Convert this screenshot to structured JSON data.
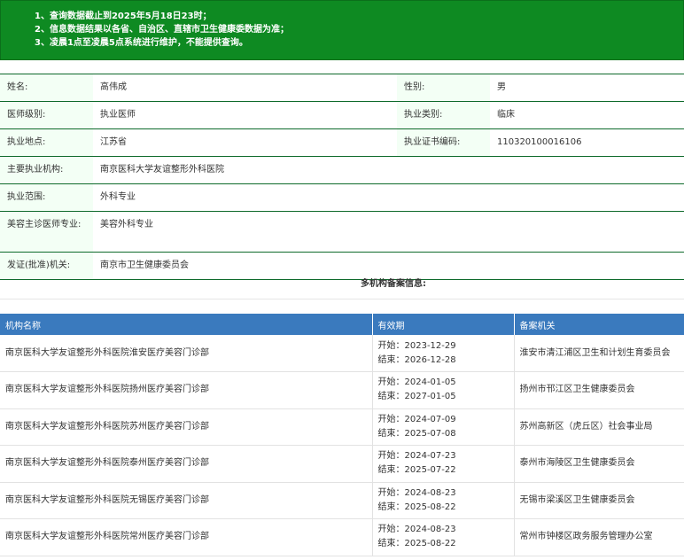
{
  "notice": [
    "1、查询数据截止到2025年5月18日23时；",
    "2、信息数据结果以各省、自治区、直辖市卫生健康委数据为准；",
    "3、凌晨1点至凌晨5点系统进行维护，不能提供查询。"
  ],
  "info": {
    "name_label": "姓名:",
    "name": "高伟成",
    "gender_label": "性别:",
    "gender": "男",
    "level_label": "医师级别:",
    "level": "执业医师",
    "category_label": "执业类别:",
    "category": "临床",
    "location_label": "执业地点:",
    "location": "江苏省",
    "cert_label": "执业证书编码:",
    "cert": "110320100016106",
    "org_label": "主要执业机构:",
    "org": "南京医科大学友谊整形外科医院",
    "scope_label": "执业范围:",
    "scope": "外科专业",
    "cosmetic_label": "美容主诊医师专业:",
    "cosmetic": "美容外科专业",
    "issuer_label": "发证(批准)机关:",
    "issuer": "南京市卫生健康委员会"
  },
  "multi_heading": "多机构备案信息:",
  "table": {
    "headers": [
      "机构名称",
      "有效期",
      "备案机关"
    ],
    "rows": [
      {
        "name": "南京医科大学友谊整形外科医院淮安医疗美容门诊部",
        "start": "开始：2023-12-29",
        "end": "结束：2026-12-28",
        "authority": "淮安市清江浦区卫生和计划生育委员会"
      },
      {
        "name": "南京医科大学友谊整形外科医院扬州医疗美容门诊部",
        "start": "开始：2024-01-05",
        "end": "结束：2027-01-05",
        "authority": "扬州市邗江区卫生健康委员会"
      },
      {
        "name": "南京医科大学友谊整形外科医院苏州医疗美容门诊部",
        "start": "开始：2024-07-09",
        "end": "结束：2025-07-08",
        "authority": "苏州高新区（虎丘区）社会事业局"
      },
      {
        "name": "南京医科大学友谊整形外科医院泰州医疗美容门诊部",
        "start": "开始：2024-07-23",
        "end": "结束：2025-07-22",
        "authority": "泰州市海陵区卫生健康委员会"
      },
      {
        "name": "南京医科大学友谊整形外科医院无锡医疗美容门诊部",
        "start": "开始：2024-08-23",
        "end": "结束：2025-08-22",
        "authority": "无锡市梁溪区卫生健康委员会"
      },
      {
        "name": "南京医科大学友谊整形外科医院常州医疗美容门诊部",
        "start": "开始：2024-08-23",
        "end": "结束：2025-08-22",
        "authority": "常州市钟楼区政务服务管理办公室"
      }
    ]
  },
  "colors": {
    "notice_bg": "#0e8a22",
    "table_header_bg": "#3a7abe",
    "label_bg": "#f3fff5"
  }
}
